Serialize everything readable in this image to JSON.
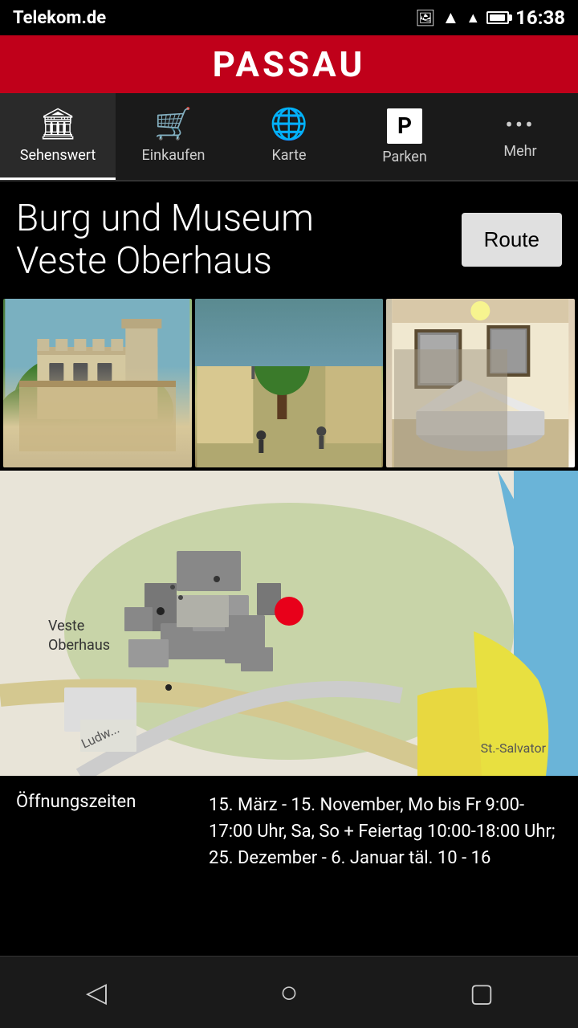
{
  "status_bar": {
    "carrier": "Telekom.de",
    "time": "16:38"
  },
  "header": {
    "title": "PASSAU"
  },
  "nav_tabs": [
    {
      "id": "sehenswert",
      "label": "Sehenswert",
      "icon": "museum-icon",
      "active": true
    },
    {
      "id": "einkaufen",
      "label": "Einkaufen",
      "icon": "cart-icon",
      "active": false
    },
    {
      "id": "karte",
      "label": "Karte",
      "icon": "globe-icon",
      "active": false
    },
    {
      "id": "parken",
      "label": "Parken",
      "icon": "parking-icon",
      "active": false
    },
    {
      "id": "mehr",
      "label": "Mehr",
      "icon": "more-icon",
      "active": false
    }
  ],
  "place": {
    "title_line1": "Burg und Museum",
    "title_line2": "Veste Oberhaus",
    "route_button": "Route"
  },
  "photos": [
    {
      "alt": "Außenansicht Burg"
    },
    {
      "alt": "Innenhof"
    },
    {
      "alt": "Innenraum Museum"
    }
  ],
  "map": {
    "label_veste_line1": "Veste",
    "label_veste_line2": "Oberhaus",
    "label_ludwig": "Ludw...",
    "label_salvator": "St.-Salvator"
  },
  "info": {
    "opening_label": "Öffnungszeiten",
    "opening_value": "15. März - 15. November, Mo bis Fr 9:00-17:00 Uhr, Sa, So + Feiertag 10:00-18:00 Uhr; 25. Dezember - 6. Januar täl. 10 - 16"
  },
  "bottom_nav": {
    "back_label": "Back",
    "home_label": "Home",
    "recent_label": "Recent"
  }
}
